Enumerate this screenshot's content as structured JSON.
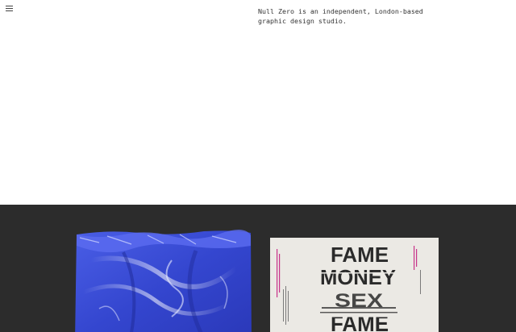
{
  "header": {
    "menu_icon": "hamburger-menu-icon",
    "intro_text": "Null Zero is an independent, London-based graphic design studio."
  },
  "gallery": {
    "items": [
      {
        "subject": "blue plastic packaging bag"
      },
      {
        "subject": "typographic poster",
        "headline_words": [
          "FAME",
          "MONEY",
          "SEX",
          "FAME"
        ]
      }
    ]
  },
  "colors": {
    "background": "#ffffff",
    "gallery_background": "#2c2c2c",
    "bag_blue": "#3c4fd6",
    "poster_paper": "#e9e7e2",
    "poster_ink": "#2b2b2b",
    "accent_magenta": "#c8348a"
  }
}
